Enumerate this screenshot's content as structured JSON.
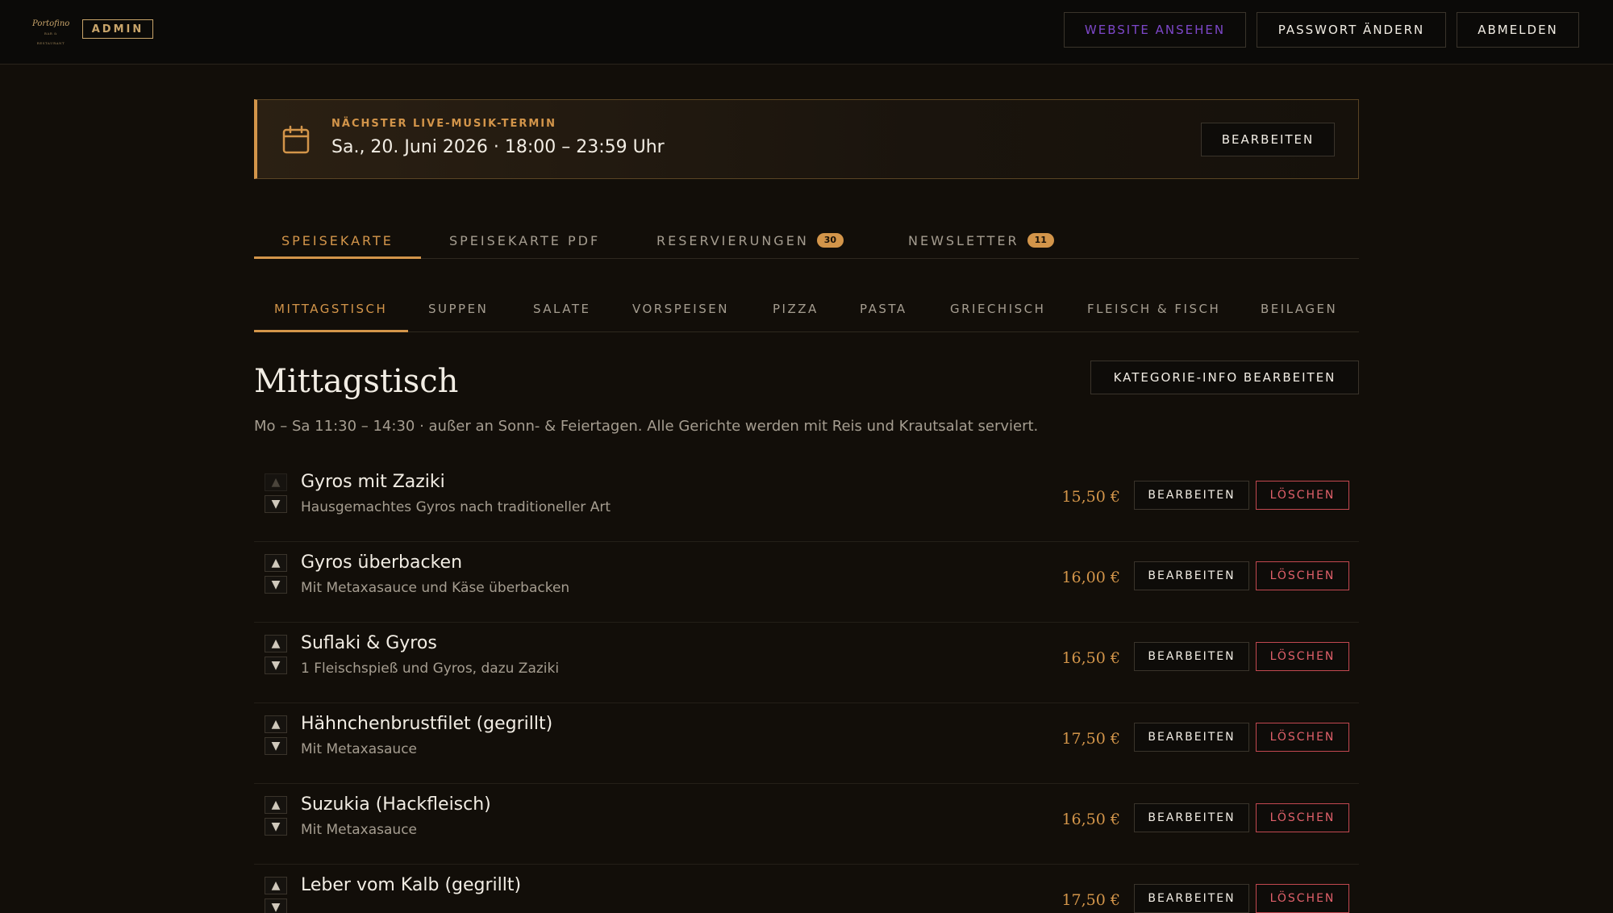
{
  "header": {
    "logo_text": "Portofino",
    "logo_sub": "BAR & RESTAURANT",
    "admin_label": "ADMIN",
    "view_site_label": "WEBSITE ANSEHEN",
    "change_password_label": "PASSWORT ÄNDERN",
    "logout_label": "ABMELDEN"
  },
  "banner": {
    "label": "NÄCHSTER LIVE-MUSIK-TERMIN",
    "date": "Sa., 20. Juni 2026 · 18:00 – 23:59 Uhr",
    "edit_label": "BEARBEITEN",
    "icon": "calendar-icon"
  },
  "tabs": [
    {
      "label": "SPEISEKARTE",
      "active": true
    },
    {
      "label": "SPEISEKARTE PDF"
    },
    {
      "label": "RESERVIERUNGEN",
      "count": "30"
    },
    {
      "label": "NEWSLETTER",
      "count": "11"
    }
  ],
  "categories": [
    {
      "label": "MITTAGSTISCH",
      "active": true
    },
    {
      "label": "SUPPEN"
    },
    {
      "label": "SALATE"
    },
    {
      "label": "VORSPEISEN"
    },
    {
      "label": "PIZZA"
    },
    {
      "label": "PASTA"
    },
    {
      "label": "GRIECHISCH"
    },
    {
      "label": "FLEISCH & FISCH"
    },
    {
      "label": "BEILAGEN"
    }
  ],
  "section": {
    "title": "Mittagstisch",
    "description": "Mo – Sa 11:30 – 14:30 · außer an Sonn- & Feiertagen. Alle Gerichte werden mit Reis und Krautsalat serviert.",
    "category_info_label": "KATEGORIE-INFO BEARBEITEN"
  },
  "item_actions": {
    "edit_label": "BEARBEITEN",
    "delete_label": "LÖSCHEN",
    "up_glyph": "▲",
    "down_glyph": "▼"
  },
  "items": [
    {
      "name": "Gyros mit Zaziki",
      "description": "Hausgemachtes Gyros nach traditioneller Art",
      "price": "15,50 €"
    },
    {
      "name": "Gyros überbacken",
      "description": "Mit Metaxasauce und Käse überbacken",
      "price": "16,00 €"
    },
    {
      "name": "Suflaki & Gyros",
      "description": "1 Fleischspieß und Gyros, dazu Zaziki",
      "price": "16,50 €"
    },
    {
      "name": "Hähnchenbrustfilet (gegrillt)",
      "description": "Mit Metaxasauce",
      "price": "17,50 €"
    },
    {
      "name": "Suzukia (Hackfleisch)",
      "description": "Mit Metaxasauce",
      "price": "16,50 €"
    },
    {
      "name": "Leber vom Kalb (gegrillt)",
      "description": "",
      "price": "17,50 €"
    }
  ],
  "colors": {
    "accent": "#d3954a",
    "danger": "#e0606a",
    "background": "#120e09",
    "view_site": "#7d47c9"
  }
}
